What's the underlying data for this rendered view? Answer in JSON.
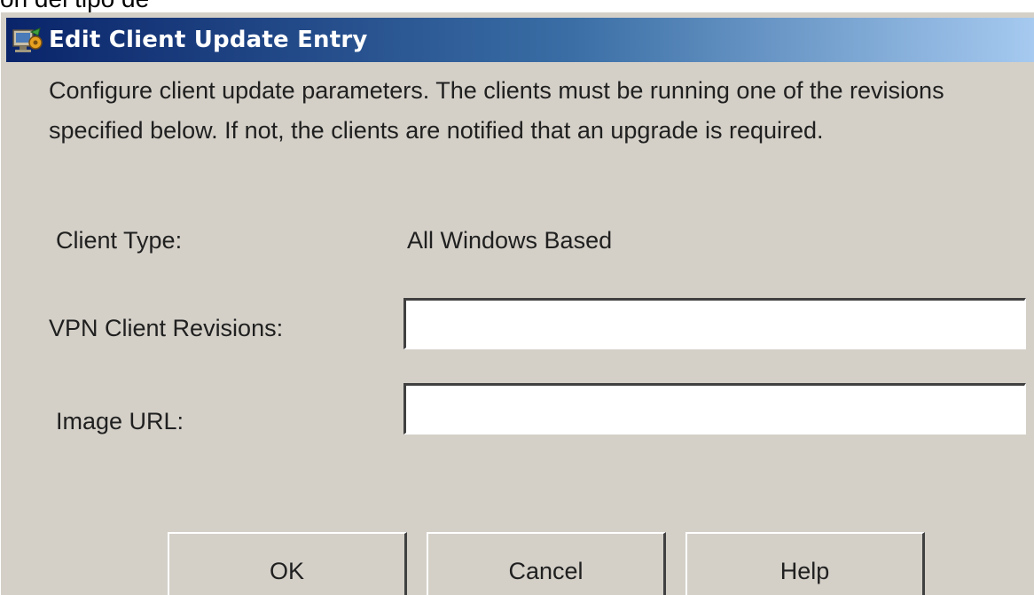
{
  "background_text": "on del tipo de",
  "dialog": {
    "title": "Edit Client Update Entry",
    "title_icon": "network-config-icon",
    "description": "Configure client update parameters.  The clients must be running one of the revisions specified below.  If not, the clients are notified that an upgrade is required.",
    "client_type": {
      "label": "Client Type:",
      "value": "All Windows Based"
    },
    "vpn_revisions": {
      "label": "VPN Client Revisions:",
      "value": "",
      "placeholder": ""
    },
    "image_url": {
      "label": "Image URL:",
      "value": "",
      "placeholder": ""
    },
    "buttons": {
      "ok": "OK",
      "cancel": "Cancel",
      "help": "Help"
    }
  },
  "colors": {
    "dialog_bg": "#d4d0c8",
    "titlebar_start": "#0a246a",
    "titlebar_end": "#a6caf0",
    "title_text": "#ffffff"
  }
}
